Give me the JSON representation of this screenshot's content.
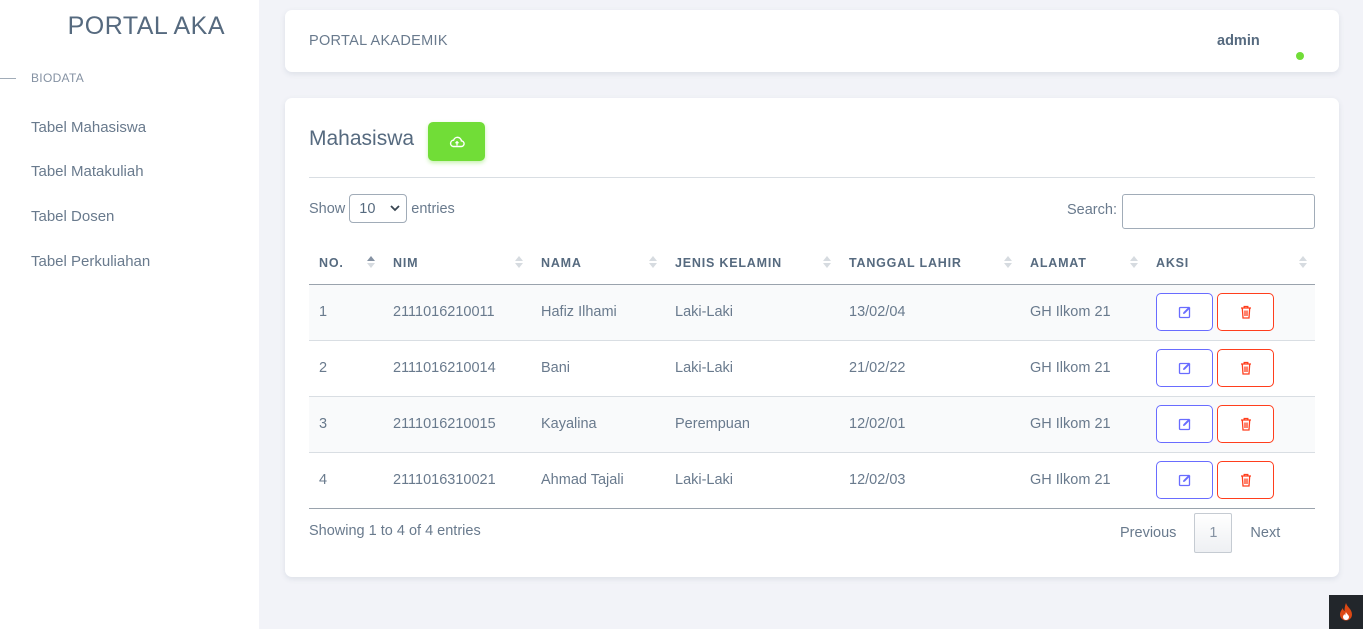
{
  "sidebar": {
    "brand": "PORTAL AKA",
    "section": "BIODATA",
    "items": [
      {
        "label": "Tabel Mahasiswa"
      },
      {
        "label": "Tabel Matakuliah"
      },
      {
        "label": "Tabel Dosen"
      },
      {
        "label": "Tabel Perkuliahan"
      }
    ]
  },
  "topbar": {
    "title": "PORTAL AKADEMIK",
    "user": "admin",
    "status_color": "#71dd37"
  },
  "main": {
    "heading": "Mahasiswa",
    "upload_icon": "cloud-upload-icon",
    "show_label": "Show",
    "entries_value": "10",
    "entries_label": "entries",
    "search_label": "Search:",
    "search_value": "",
    "columns": [
      "NO.",
      "NIM",
      "NAMA",
      "JENIS KELAMIN",
      "TANGGAL LAHIR",
      "ALAMAT",
      "AKSI"
    ],
    "rows": [
      {
        "no": "1",
        "nim": "2111016210011",
        "nama": "Hafiz Ilhami",
        "jk": "Laki-Laki",
        "tgl": "13/02/04",
        "alamat": "GH Ilkom 21"
      },
      {
        "no": "2",
        "nim": "2111016210014",
        "nama": "Bani",
        "jk": "Laki-Laki",
        "tgl": "21/02/22",
        "alamat": "GH Ilkom 21"
      },
      {
        "no": "3",
        "nim": "2111016210015",
        "nama": "Kayalina",
        "jk": "Perempuan",
        "tgl": "12/02/01",
        "alamat": "GH Ilkom 21"
      },
      {
        "no": "4",
        "nim": "2111016310021",
        "nama": "Ahmad Tajali",
        "jk": "Laki-Laki",
        "tgl": "12/02/03",
        "alamat": "GH Ilkom 21"
      }
    ],
    "info": "Showing 1 to 4 of 4 entries",
    "pager": {
      "prev": "Previous",
      "page": "1",
      "next": "Next"
    }
  },
  "colors": {
    "accent_success": "#71dd37",
    "accent_primary": "#696cff",
    "accent_danger": "#ff3e1d"
  }
}
